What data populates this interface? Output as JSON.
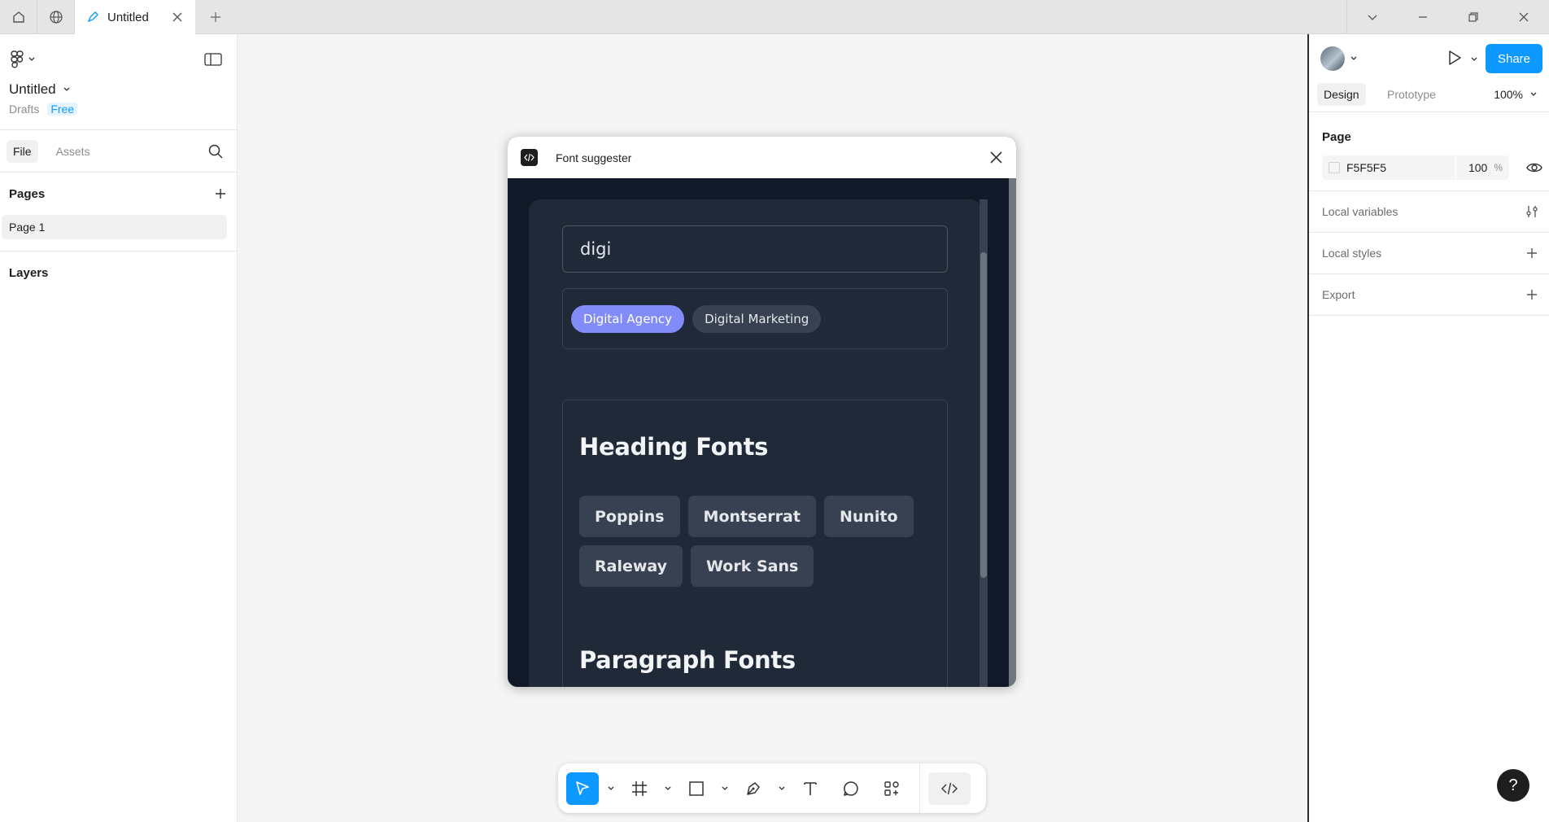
{
  "tabbar": {
    "home_icon": "home-icon",
    "community_icon": "globe-icon",
    "active_tab_title": "Untitled",
    "new_tab_icon": "plus-icon"
  },
  "file": {
    "title": "Untitled",
    "location": "Drafts",
    "plan": "Free"
  },
  "left_panel": {
    "tabs": [
      "File",
      "Assets"
    ],
    "pages_label": "Pages",
    "pages": [
      "Page 1"
    ],
    "layers_label": "Layers"
  },
  "right_panel": {
    "share_label": "Share",
    "tabs": [
      "Design",
      "Prototype"
    ],
    "zoom": "100%",
    "page_section": "Page",
    "page_fill_hex": "F5F5F5",
    "page_fill_opacity": "100",
    "opacity_unit": "%",
    "rows": [
      "Local variables",
      "Local styles",
      "Export"
    ],
    "help_label": "?"
  },
  "plugin": {
    "title": "Font suggester",
    "search_value": "digi",
    "suggestions": [
      "Digital Agency",
      "Digital Marketing"
    ],
    "selected_suggestion": "Digital Agency",
    "heading_section": "Heading Fonts",
    "heading_fonts": [
      "Poppins",
      "Montserrat",
      "Nunito",
      "Raleway",
      "Work Sans"
    ],
    "paragraph_section": "Paragraph Fonts"
  },
  "colors": {
    "accent": "#0d99ff",
    "plugin_bg": "#111827",
    "card_bg": "#1f2937",
    "chip_bg": "#374151",
    "chip_selected": "#818cf8"
  }
}
